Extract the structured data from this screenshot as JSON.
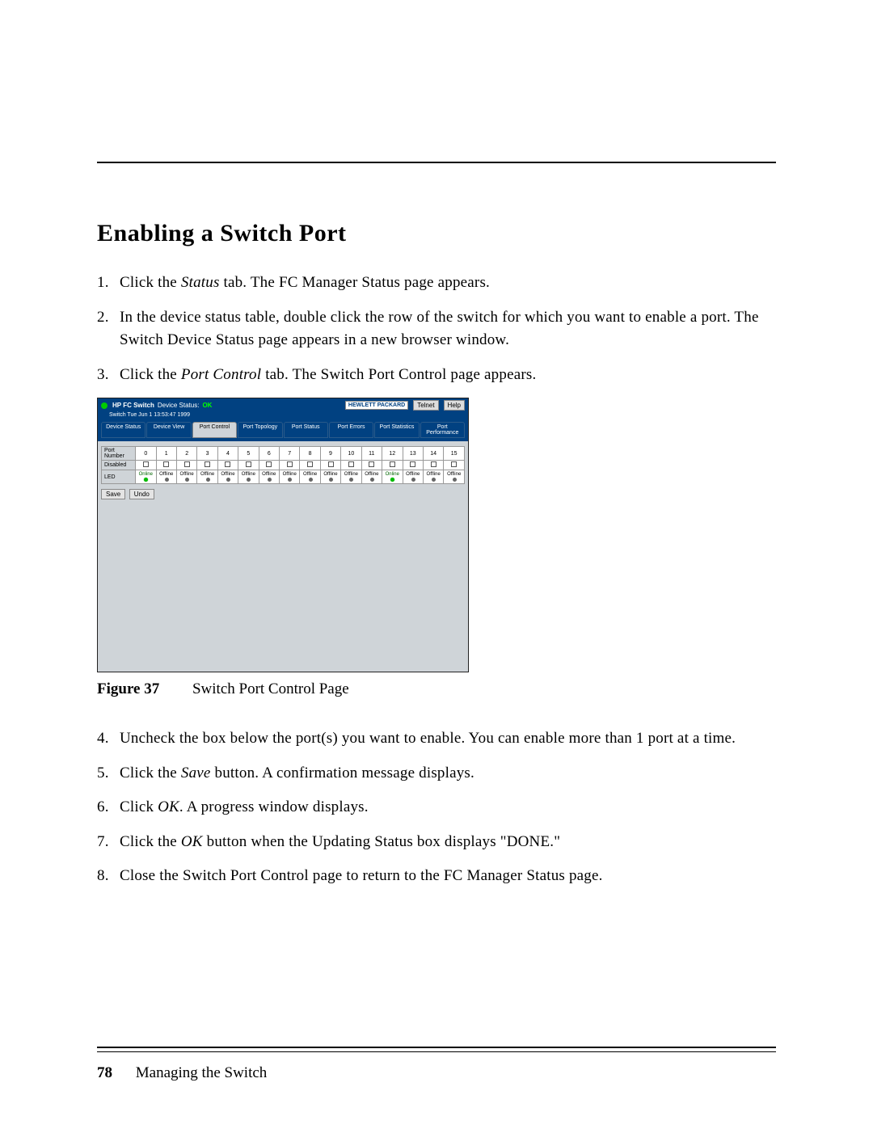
{
  "section_title": "Enabling a Switch Port",
  "steps": [
    {
      "n": "1",
      "pre": "Click the ",
      "em": "Status",
      "post": " tab. The FC Manager Status page appears."
    },
    {
      "n": "2",
      "text": "In the device status table, double click the row of the switch for which you want to enable a port. The Switch Device Status page appears in a new browser window."
    },
    {
      "n": "3",
      "pre": "Click the ",
      "em": "Port Control",
      "post": " tab. The Switch Port Control page appears."
    }
  ],
  "steps2": [
    {
      "n": "4",
      "text": "Uncheck the box below the port(s) you want to enable. You can enable more than 1 port at a time."
    },
    {
      "n": "5",
      "pre": "Click the ",
      "em": "Save",
      "post": " button. A confirmation message displays."
    },
    {
      "n": "6",
      "pre": "Click ",
      "em": "OK",
      "post": ". A progress window displays."
    },
    {
      "n": "7",
      "pre": "Click the ",
      "em": "OK",
      "post": " button when the Updating Status box displays \"DONE.\""
    },
    {
      "n": "8",
      "text": "Close the Switch Port Control page to return to the FC Manager Status page."
    }
  ],
  "figure": {
    "label": "Figure 37",
    "caption": "Switch Port Control Page"
  },
  "screenshot": {
    "header_title": "HP FC Switch",
    "header_status_label": "Device Status:",
    "header_status_value": "OK",
    "subheader": "Switch   Tue Jun 1 13:53:47 1999",
    "logo": "HEWLETT PACKARD",
    "btn_telnet": "Telnet",
    "btn_help": "Help",
    "tabs": [
      "Device Status",
      "Device View",
      "Port Control",
      "Port Topology",
      "Port Status",
      "Port Errors",
      "Port Statistics",
      "Port Performance"
    ],
    "active_tab": 2,
    "row_labels": {
      "num": "Port Number",
      "disabled": "Disabled",
      "led": "LED"
    },
    "btn_save": "Save",
    "btn_undo": "Undo"
  },
  "chart_data": {
    "type": "table",
    "title": "Switch Port Control",
    "columns": [
      "Port",
      "Disabled",
      "LED"
    ],
    "ports": [
      0,
      1,
      2,
      3,
      4,
      5,
      6,
      7,
      8,
      9,
      10,
      11,
      12,
      13,
      14,
      15
    ],
    "disabled": [
      false,
      false,
      false,
      false,
      false,
      false,
      false,
      false,
      false,
      false,
      false,
      false,
      false,
      false,
      false,
      false
    ],
    "led": [
      "Online",
      "Offline",
      "Offline",
      "Offline",
      "Offline",
      "Offline",
      "Offline",
      "Offline",
      "Offline",
      "Offline",
      "Offline",
      "Offline",
      "Online",
      "Offline",
      "Offline",
      "Offline"
    ]
  },
  "footer": {
    "page": "78",
    "section": "Managing the Switch"
  }
}
